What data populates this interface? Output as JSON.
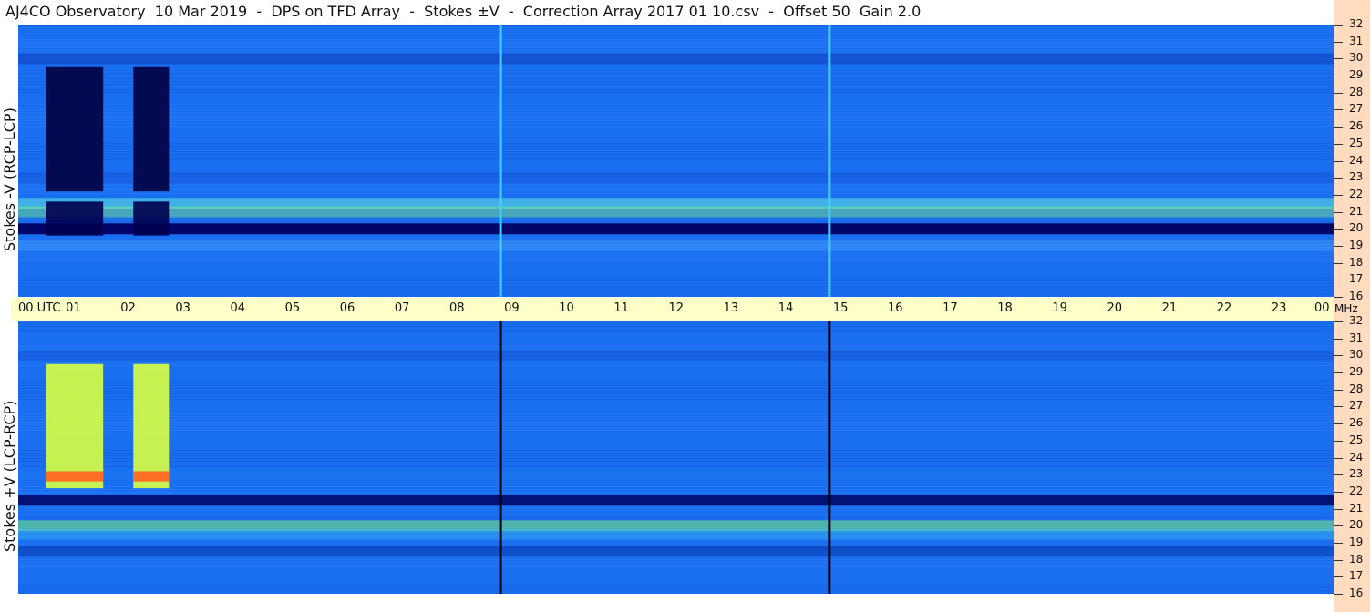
{
  "title": "AJ4CO Observatory  10 Mar 2019  -  DPS on TFD Array  -  Stokes ±V  -  Correction Array 2017 01 10.csv  -  Offset 50  Gain 2.0",
  "ylabels": {
    "top": "Stokes -V (RCP-LCP)",
    "bottom": "Stokes +V (LCP-RCP)"
  },
  "time_labels": [
    "00 UTC",
    "01",
    "02",
    "03",
    "04",
    "05",
    "06",
    "07",
    "08",
    "09",
    "10",
    "11",
    "12",
    "13",
    "14",
    "15",
    "16",
    "17",
    "18",
    "19",
    "20",
    "21",
    "22",
    "23",
    "00"
  ],
  "freq_unit": "MHz",
  "freq_labels_top": [
    "32",
    "31",
    "30",
    "29",
    "28",
    "27",
    "26",
    "25",
    "24",
    "23",
    "22",
    "21",
    "20",
    "19",
    "18",
    "17",
    "16"
  ],
  "freq_labels_bottom": [
    "32",
    "31",
    "30",
    "29",
    "28",
    "27",
    "26",
    "25",
    "24",
    "23",
    "22",
    "21",
    "20",
    "19",
    "18",
    "17",
    "16"
  ],
  "chart_data": [
    {
      "type": "heatmap",
      "title": "Stokes -V (RCP-LCP)",
      "x": "UTC hour 0-24",
      "y": "Frequency 16-32 MHz",
      "colormap": [
        "#00007a",
        "#0050e0",
        "#1a90ff",
        "#40c8f0",
        "#c8ff40",
        "#ffff40",
        "#ff8000"
      ],
      "background_color": "#1a6ef0",
      "bands": [
        {
          "mhz": 30,
          "color": "#1040c0",
          "strength": 0.6
        },
        {
          "mhz": 23,
          "color": "#1050d0",
          "strength": 0.45
        },
        {
          "mhz": 21.5,
          "color": "#60e8e0",
          "strength": 0.55
        },
        {
          "mhz": 21,
          "color": "#80f080",
          "strength": 0.45
        },
        {
          "mhz": 20,
          "color": "#000060",
          "strength": 0.95
        },
        {
          "mhz": 19,
          "color": "#60b8ff",
          "strength": 0.3
        }
      ],
      "blocks": [
        {
          "t0": 0.5,
          "t1": 1.55,
          "mhz0": 22.2,
          "mhz1": 29.5,
          "color": "#000040"
        },
        {
          "t0": 2.1,
          "t1": 2.75,
          "mhz0": 22.2,
          "mhz1": 29.5,
          "color": "#000040"
        },
        {
          "t0": 0.5,
          "t1": 1.55,
          "mhz0": 19.6,
          "mhz1": 21.6,
          "color": "#000050"
        },
        {
          "t0": 2.1,
          "t1": 2.75,
          "mhz0": 19.6,
          "mhz1": 21.6,
          "color": "#000050"
        }
      ],
      "vlines": [
        {
          "t": 8.8,
          "color": "#40d0ff"
        },
        {
          "t": 14.8,
          "color": "#40d0ff"
        }
      ]
    },
    {
      "type": "heatmap",
      "title": "Stokes +V (LCP-RCP)",
      "x": "UTC hour 0-24",
      "y": "Frequency 16-32 MHz",
      "colormap": [
        "#00007a",
        "#0050e0",
        "#1a90ff",
        "#40c8f0",
        "#c8ff40",
        "#ffff40",
        "#ff8000"
      ],
      "background_color": "#1a6ef0",
      "bands": [
        {
          "mhz": 30,
          "color": "#1050d0",
          "strength": 0.45
        },
        {
          "mhz": 23,
          "color": "#1a80f0",
          "strength": 0.3
        },
        {
          "mhz": 21.5,
          "color": "#000060",
          "strength": 0.85
        },
        {
          "mhz": 20,
          "color": "#80f080",
          "strength": 0.55
        },
        {
          "mhz": 19.5,
          "color": "#40c8f0",
          "strength": 0.4
        },
        {
          "mhz": 18.5,
          "color": "#0030a0",
          "strength": 0.5
        }
      ],
      "blocks": [
        {
          "t0": 0.5,
          "t1": 1.55,
          "mhz0": 22.2,
          "mhz1": 29.5,
          "color": "#d8ff40"
        },
        {
          "t0": 2.1,
          "t1": 2.75,
          "mhz0": 22.2,
          "mhz1": 29.5,
          "color": "#d8ff40"
        },
        {
          "t0": 0.5,
          "t1": 1.55,
          "mhz0": 22.6,
          "mhz1": 23.2,
          "color": "#ff6020"
        },
        {
          "t0": 2.1,
          "t1": 2.75,
          "mhz0": 22.6,
          "mhz1": 23.2,
          "color": "#ff6020"
        }
      ],
      "vlines": [
        {
          "t": 8.8,
          "color": "#000010"
        },
        {
          "t": 14.8,
          "color": "#000010"
        }
      ]
    }
  ]
}
